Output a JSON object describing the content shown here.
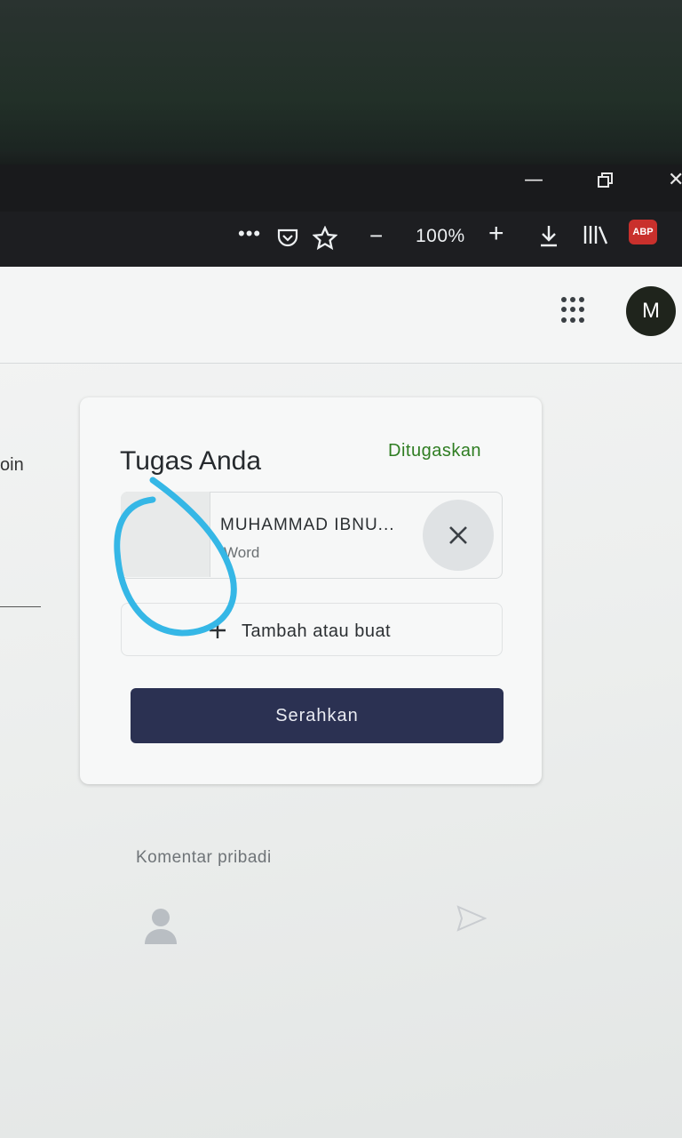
{
  "browser": {
    "zoom_level": "100%",
    "adblock_badge": "ABP",
    "icons": [
      "more-icon",
      "pocket-icon",
      "bookmark-star-icon",
      "zoom-out-icon",
      "zoom-in-icon",
      "download-icon",
      "library-icon",
      "adblock-icon",
      "minimize-icon",
      "restore-icon",
      "close-window-icon"
    ]
  },
  "header": {
    "avatar_initial": "M"
  },
  "left_panel": {
    "cut_text": "oin"
  },
  "assignment": {
    "title": "Tugas Anda",
    "status": "Ditugaskan",
    "attachment_name": "MUHAMMAD IBNU...",
    "attachment_type": "Word",
    "add_label": "Tambah atau buat",
    "submit_label": "Serahkan"
  },
  "comments": {
    "private_label": "Komentar pribadi"
  },
  "colors": {
    "status_green": "#2f7d22",
    "submit_bg": "#2b3152",
    "annotation_blue": "#35b7e6"
  }
}
